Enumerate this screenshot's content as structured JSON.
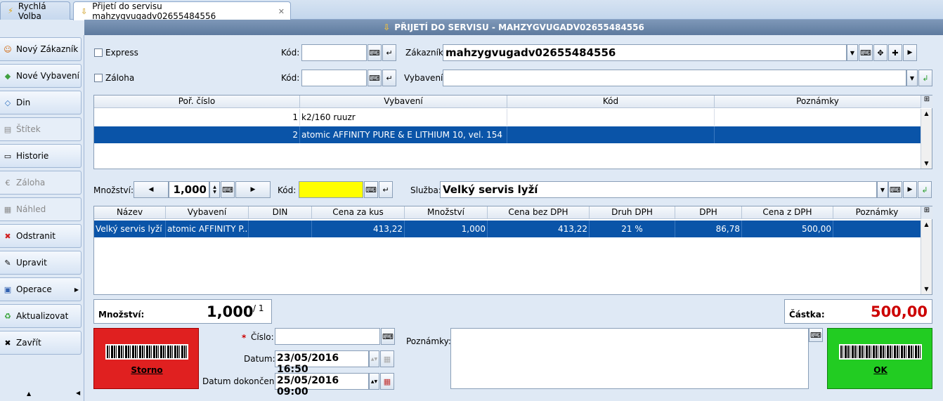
{
  "tabs": [
    {
      "label": "Rychlá Volba"
    },
    {
      "label": "Přijetí do servisu mahzygvugadv02655484556"
    }
  ],
  "window_title": "PŘIJETÍ DO SERVISU - MAHZYGVUGADV02655484556",
  "sidebar": {
    "items": [
      {
        "label": "Nový Zákazník",
        "icon": "new-customer-icon"
      },
      {
        "label": "Nové Vybavení",
        "icon": "new-equipment-icon"
      },
      {
        "label": "Din",
        "icon": "din-icon"
      },
      {
        "label": "Štítek",
        "icon": "label-print-icon"
      },
      {
        "label": "Historie",
        "icon": "history-icon"
      },
      {
        "label": "Záloha",
        "icon": "deposit-icon"
      },
      {
        "label": "Náhled",
        "icon": "preview-icon"
      },
      {
        "label": "Odstranit",
        "icon": "delete-icon"
      },
      {
        "label": "Upravit",
        "icon": "edit-icon"
      },
      {
        "label": "Operace",
        "icon": "operations-icon"
      },
      {
        "label": "Aktualizovat",
        "icon": "refresh-icon"
      },
      {
        "label": "Zavřít",
        "icon": "close-icon"
      }
    ]
  },
  "form": {
    "express_label": "Express",
    "zaloha_label": "Záloha",
    "kod_label": "Kód:",
    "zakaznik_label": "Zákazník:",
    "zakaznik_value": "mahzygvugadv02655484556",
    "vybaveni_label": "Vybavení:",
    "vybaveni_value": ""
  },
  "equipment_table": {
    "columns": [
      "Poř. číslo",
      "Vybavení",
      "Kód",
      "Poznámky"
    ],
    "rows": [
      {
        "num": "1",
        "vybaveni": "k2/160 ruuzr",
        "kod": "",
        "poznamky": ""
      },
      {
        "num": "2",
        "vybaveni": "atomic AFFINITY PURE & E LITHIUM 10, vel. 154",
        "kod": "",
        "poznamky": ""
      }
    ]
  },
  "service_row": {
    "mnozstvi_label": "Množství:",
    "mnozstvi_value": "1,000",
    "kod_label": "Kód:",
    "kod_value": "",
    "sluzba_label": "Služba:",
    "sluzba_value": "Velký servis lyží"
  },
  "services_table": {
    "columns": [
      "Název",
      "Vybavení",
      "DIN",
      "Cena za kus",
      "Množství",
      "Cena bez DPH",
      "Druh DPH",
      "DPH",
      "Cena z DPH",
      "Poznámky"
    ],
    "rows": [
      {
        "nazev": "Velký servis lyží",
        "vybaveni": "atomic AFFINITY P...",
        "din": "",
        "cena_za_kus": "413,22",
        "mnozstvi": "1,000",
        "cena_bez_dph": "413,22",
        "druh_dph": "21 %",
        "dph": "86,78",
        "cena_z_dph": "500,00",
        "poznamky": ""
      }
    ]
  },
  "summary": {
    "mnozstvi_label": "Množství:",
    "mnozstvi_value": "1,000",
    "mnozstvi_count": "/ 1",
    "castka_label": "Částka:",
    "castka_value": "500,00"
  },
  "bottom": {
    "storno_label": "Storno",
    "ok_label": "OK",
    "cislo_label": "Číslo:",
    "cislo_required": "*",
    "cislo_value": "",
    "datum_label": "Datum:",
    "datum_value": "23/05/2016 16:50",
    "datum_dokonceni_label": "Datum dokončení:",
    "datum_dokonceni_value": "25/05/2016 09:00",
    "poznamky_label": "Poznámky:"
  },
  "colors": {
    "selection": "#0a54a8",
    "kod_highlight": "#ffff00",
    "castka_red": "#cc0000",
    "storno_red": "#e02020",
    "ok_green": "#22cc22"
  }
}
